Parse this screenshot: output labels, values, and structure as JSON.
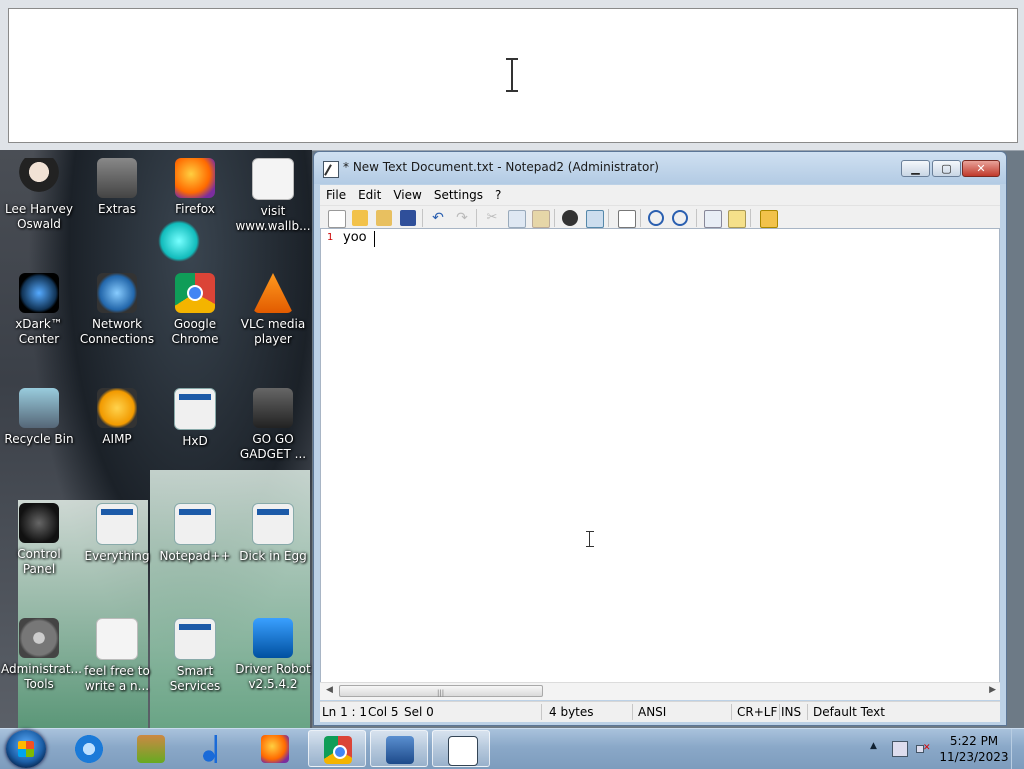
{
  "desktop_icons": [
    {
      "label": "Lee Harvey Oswald",
      "icon": "person-icon"
    },
    {
      "label": "Extras",
      "icon": "folder-icon"
    },
    {
      "label": "Firefox",
      "icon": "firefox-icon"
    },
    {
      "label": "visit www.wallb...",
      "icon": "document-icon"
    },
    {
      "label": "xDark™ Center",
      "icon": "orb-icon"
    },
    {
      "label": "Network Connections",
      "icon": "network-icon"
    },
    {
      "label": "Google Chrome",
      "icon": "chrome-icon"
    },
    {
      "label": "VLC media player",
      "icon": "vlc-icon"
    },
    {
      "label": "Recycle Bin",
      "icon": "recycle-bin-icon"
    },
    {
      "label": "AIMP",
      "icon": "aimp-icon"
    },
    {
      "label": "HxD",
      "icon": "app-icon"
    },
    {
      "label": "GO GO GADGET ...",
      "icon": "gadget-icon"
    },
    {
      "label": "Control Panel",
      "icon": "control-panel-icon"
    },
    {
      "label": "Everything",
      "icon": "app-icon"
    },
    {
      "label": "Notepad++",
      "icon": "app-icon"
    },
    {
      "label": "Dick in Egg",
      "icon": "app-icon"
    },
    {
      "label": "Administrat... Tools",
      "icon": "tools-icon"
    },
    {
      "label": "feel free to write a n...",
      "icon": "document-icon"
    },
    {
      "label": "Smart Services",
      "icon": "app-icon"
    },
    {
      "label": "Driver Robot v2.5.4.2",
      "icon": "robot-icon"
    }
  ],
  "notepad": {
    "title": "* New Text Document.txt - Notepad2 (Administrator)",
    "menu": [
      "File",
      "Edit",
      "View",
      "Settings",
      "?"
    ],
    "line_number": "1",
    "content": "yoo",
    "status": {
      "position": "Ln 1 : 1",
      "col": "Col 5",
      "sel": "Sel 0",
      "size": "4 bytes",
      "encoding": "ANSI",
      "eol": "CR+LF",
      "mode": "INS",
      "scheme": "Default Text"
    }
  },
  "taskbar": {
    "time": "5:22 PM",
    "date": "11/23/2023"
  },
  "colors": {
    "taskbar": "#8aa8c8",
    "title_bar": "#bcd1e6",
    "close_button": "#c0392b"
  }
}
